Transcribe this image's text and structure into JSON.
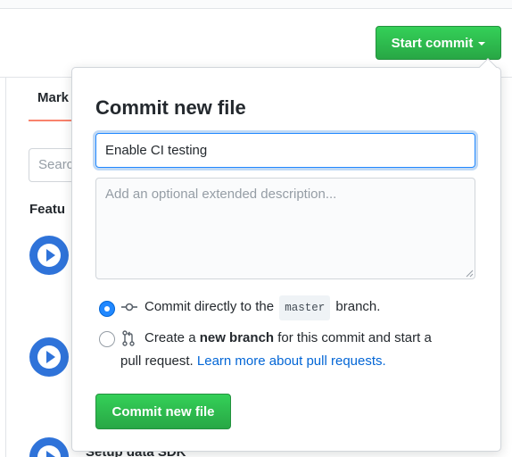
{
  "background": {
    "tab_label": "Mark",
    "search_placeholder": "Searc",
    "section_heading": "Featu",
    "bottom_item_text": "Setup data SDK"
  },
  "header": {
    "start_commit_label": "Start commit"
  },
  "commit_panel": {
    "title": "Commit new file",
    "summary_value": "Enable CI testing",
    "description_placeholder": "Add an optional extended description...",
    "options": [
      {
        "prefix": "Commit directly to the",
        "branch": "master",
        "suffix": "branch.",
        "selected": true,
        "icon": "git-commit-icon"
      },
      {
        "prefix": "Create a",
        "bold": "new branch",
        "middle": "for this commit and start a",
        "line2": "pull request.",
        "link": "Learn more about pull requests.",
        "selected": false,
        "icon": "git-pull-request-icon"
      }
    ],
    "submit_label": "Commit new file"
  },
  "colors": {
    "primary_green": "#28a745",
    "link_blue": "#0366d6",
    "radio_blue": "#2188ff",
    "play_blue": "#2f73d9"
  }
}
